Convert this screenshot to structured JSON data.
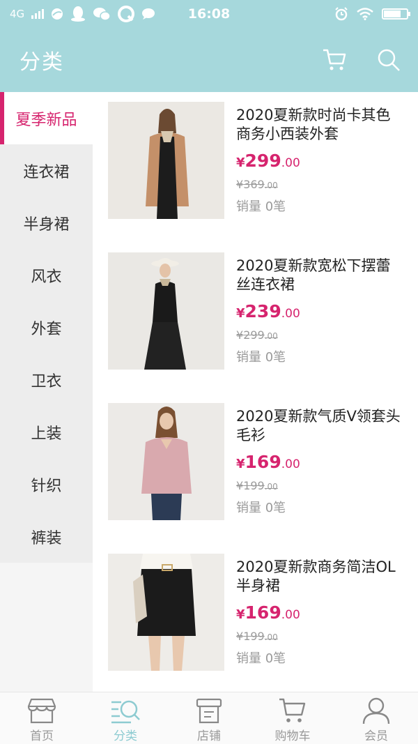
{
  "status_bar": {
    "network": "4G",
    "time": "16:08",
    "icons": [
      "signal-icon",
      "browser-icon",
      "qq-icon",
      "wechat-icon",
      "q-app-icon",
      "chat-icon",
      "alarm-icon",
      "wifi-icon",
      "battery-icon"
    ],
    "battery_level": 0.75
  },
  "header": {
    "title": "分类",
    "icons": [
      "cart-icon",
      "search-icon"
    ]
  },
  "sidebar": {
    "items": [
      {
        "label": "夏季新品",
        "active": true
      },
      {
        "label": "连衣裙",
        "active": false
      },
      {
        "label": "半身裙",
        "active": false
      },
      {
        "label": "风衣",
        "active": false
      },
      {
        "label": "外套",
        "active": false
      },
      {
        "label": "卫衣",
        "active": false
      },
      {
        "label": "上装",
        "active": false
      },
      {
        "label": "针织",
        "active": false
      },
      {
        "label": "裤装",
        "active": false
      }
    ]
  },
  "products": [
    {
      "title": "2020夏新款时尚卡其色商务小西装外套",
      "currency": "¥",
      "price_int": "299",
      "price_dec": ".00",
      "orig_int": "369",
      "orig_dec": ".00",
      "sales": "销量 0笔"
    },
    {
      "title": "2020夏新款宽松下摆蕾丝连衣裙",
      "currency": "¥",
      "price_int": "239",
      "price_dec": ".00",
      "orig_int": "299",
      "orig_dec": ".00",
      "sales": "销量 0笔"
    },
    {
      "title": "2020夏新款气质V领套头毛衫",
      "currency": "¥",
      "price_int": "169",
      "price_dec": ".00",
      "orig_int": "199",
      "orig_dec": ".00",
      "sales": "销量 0笔"
    },
    {
      "title": "2020夏新款商务简洁OL半身裙",
      "currency": "¥",
      "price_int": "169",
      "price_dec": ".00",
      "orig_int": "199",
      "orig_dec": ".00",
      "sales": "销量 0笔"
    }
  ],
  "bottom_nav": {
    "items": [
      {
        "label": "首页",
        "icon": "store-icon",
        "active": false
      },
      {
        "label": "分类",
        "icon": "category-search-icon",
        "active": true
      },
      {
        "label": "店铺",
        "icon": "shop-icon",
        "active": false
      },
      {
        "label": "购物车",
        "icon": "cart-icon",
        "active": false
      },
      {
        "label": "会员",
        "icon": "user-icon",
        "active": false
      }
    ]
  },
  "colors": {
    "header_bg": "#a6d8dc",
    "accent": "#d6246e",
    "nav_active": "#8dcbd1",
    "sidebar_bg": "#ededed"
  }
}
